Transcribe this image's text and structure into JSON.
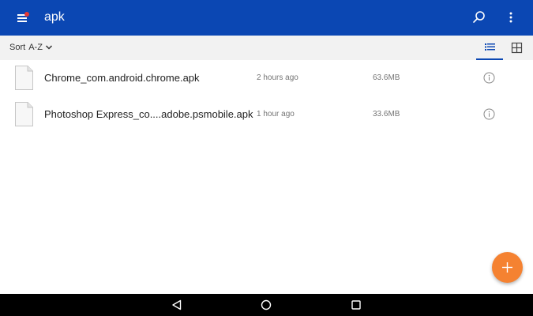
{
  "appbar": {
    "title": "apk",
    "menu_icon": "hamburger-menu-icon",
    "search_icon": "search-icon",
    "more_icon": "more-vert-icon",
    "notification_dot_color": "#e53935",
    "background": "#0b47b3"
  },
  "toolbar": {
    "sort_label": "Sort",
    "sort_value": "A-Z",
    "view_modes": [
      "list-view-icon",
      "grid-view-icon"
    ],
    "active_view": "list"
  },
  "files": [
    {
      "name": "Chrome_com.android.chrome.apk",
      "modified": "2 hours ago",
      "size": "63.6MB"
    },
    {
      "name": "Photoshop Express_co....adobe.psmobile.apk",
      "modified": "1 hour ago",
      "size": "33.6MB"
    }
  ],
  "fab": {
    "icon": "add-icon",
    "color": "#f58231"
  },
  "system_nav": {
    "icons": [
      "back-icon",
      "home-icon",
      "recents-icon"
    ]
  }
}
